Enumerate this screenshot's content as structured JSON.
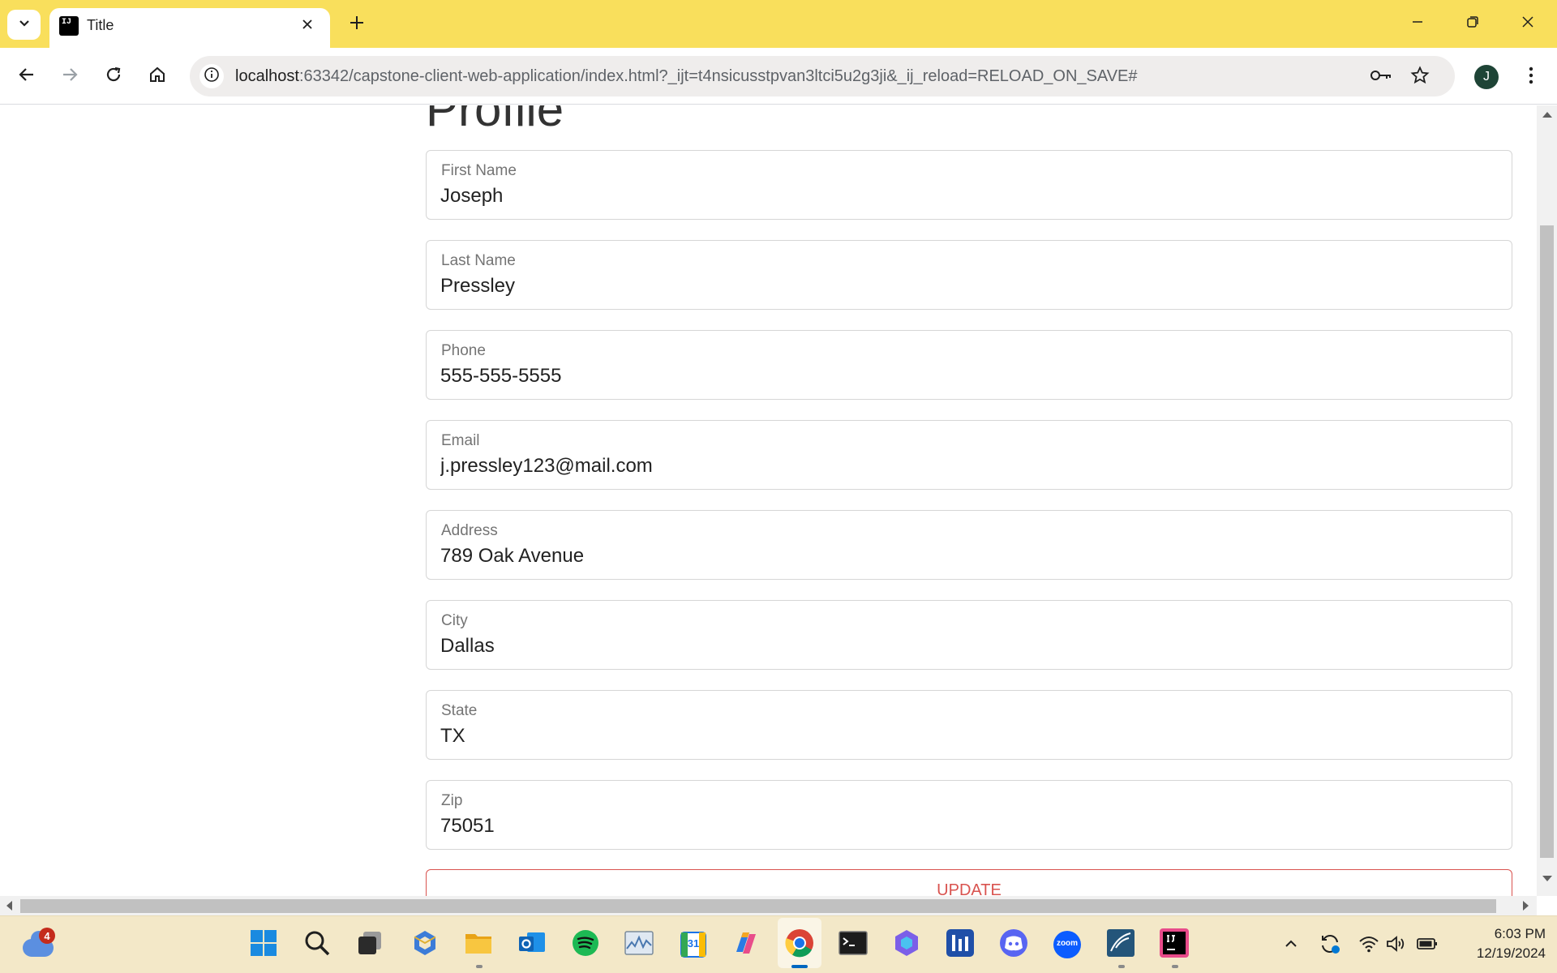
{
  "browser": {
    "tab_title": "Title",
    "url_host": "localhost",
    "url_rest": ":63342/capstone-client-web-application/index.html?_ijt=t4nsicusstpvan3ltci5u2g3ji&_ij_reload=RELOAD_ON_SAVE#",
    "profile_initial": "J",
    "favicon_text": "IJ",
    "icons": [
      "tab-search-icon",
      "close-icon",
      "plus-icon",
      "minimize-icon",
      "restore-icon",
      "close-window-icon",
      "back-icon",
      "forward-icon",
      "reload-icon",
      "home-icon",
      "info-icon",
      "key-icon",
      "star-icon",
      "menu-icon"
    ]
  },
  "page": {
    "title": "Profile",
    "fields": [
      {
        "label": "First Name",
        "value": "Joseph"
      },
      {
        "label": "Last Name",
        "value": "Pressley"
      },
      {
        "label": "Phone",
        "value": "555-555-5555"
      },
      {
        "label": "Email",
        "value": "j.pressley123@mail.com"
      },
      {
        "label": "Address",
        "value": "789 Oak Avenue"
      },
      {
        "label": "City",
        "value": "Dallas"
      },
      {
        "label": "State",
        "value": "TX"
      },
      {
        "label": "Zip",
        "value": "75051"
      }
    ],
    "update_label": "UPDATE"
  },
  "taskbar": {
    "weather_badge": "4",
    "apps": [
      "start-icon",
      "search-icon",
      "task-view-icon",
      "app-hex-icon",
      "file-explorer-icon",
      "outlook-icon",
      "spotify-icon",
      "performance-monitor-icon",
      "calendar-icon",
      "copilot-icon",
      "chrome-icon",
      "terminal-icon",
      "app-blue-icon",
      "app-bars-icon",
      "discord-icon",
      "zoom-icon",
      "mysql-workbench-icon",
      "intellij-icon"
    ],
    "calendar_day": "31",
    "zoom_label": "zoom",
    "time": "6:03 PM",
    "date": "12/19/2024"
  },
  "colors": {
    "tabstrip": "#f9df5c",
    "taskbar": "#f3e8c8",
    "update_button": "#d9534f",
    "chrome_active": "#0067c0"
  }
}
